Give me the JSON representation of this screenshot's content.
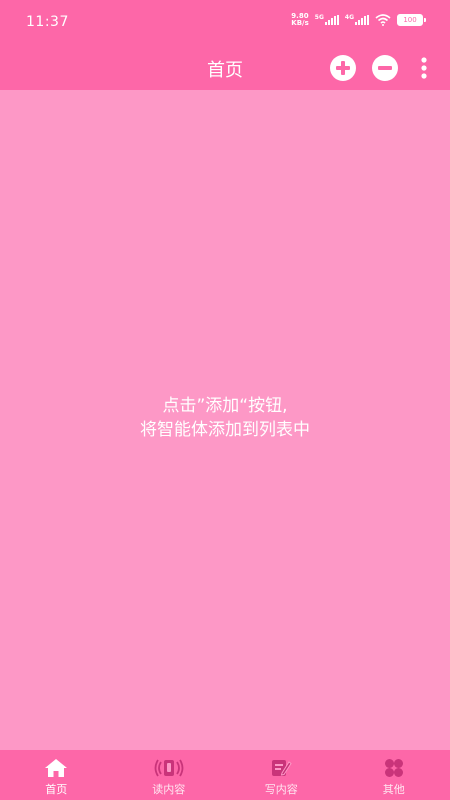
{
  "status_bar": {
    "time": "11:37",
    "net_speed_value": "9.80",
    "net_speed_unit": "KB/s",
    "signal_1_label": "5G",
    "signal_2_label": "4G",
    "battery": "100"
  },
  "app_bar": {
    "title": "首页"
  },
  "empty_state": {
    "line1": "点击”添加“按钮,",
    "line2": "将智能体添加到列表中"
  },
  "bottom_nav": {
    "items": [
      {
        "label": "首页",
        "icon": "home-icon",
        "active": true
      },
      {
        "label": "读内容",
        "icon": "read-audio-icon",
        "active": false
      },
      {
        "label": "写内容",
        "icon": "write-edit-icon",
        "active": false
      },
      {
        "label": "其他",
        "icon": "grid-icon",
        "active": false
      }
    ]
  },
  "colors": {
    "bar": "#fd67a8",
    "background": "#fd98c6",
    "text": "#ffffff"
  }
}
